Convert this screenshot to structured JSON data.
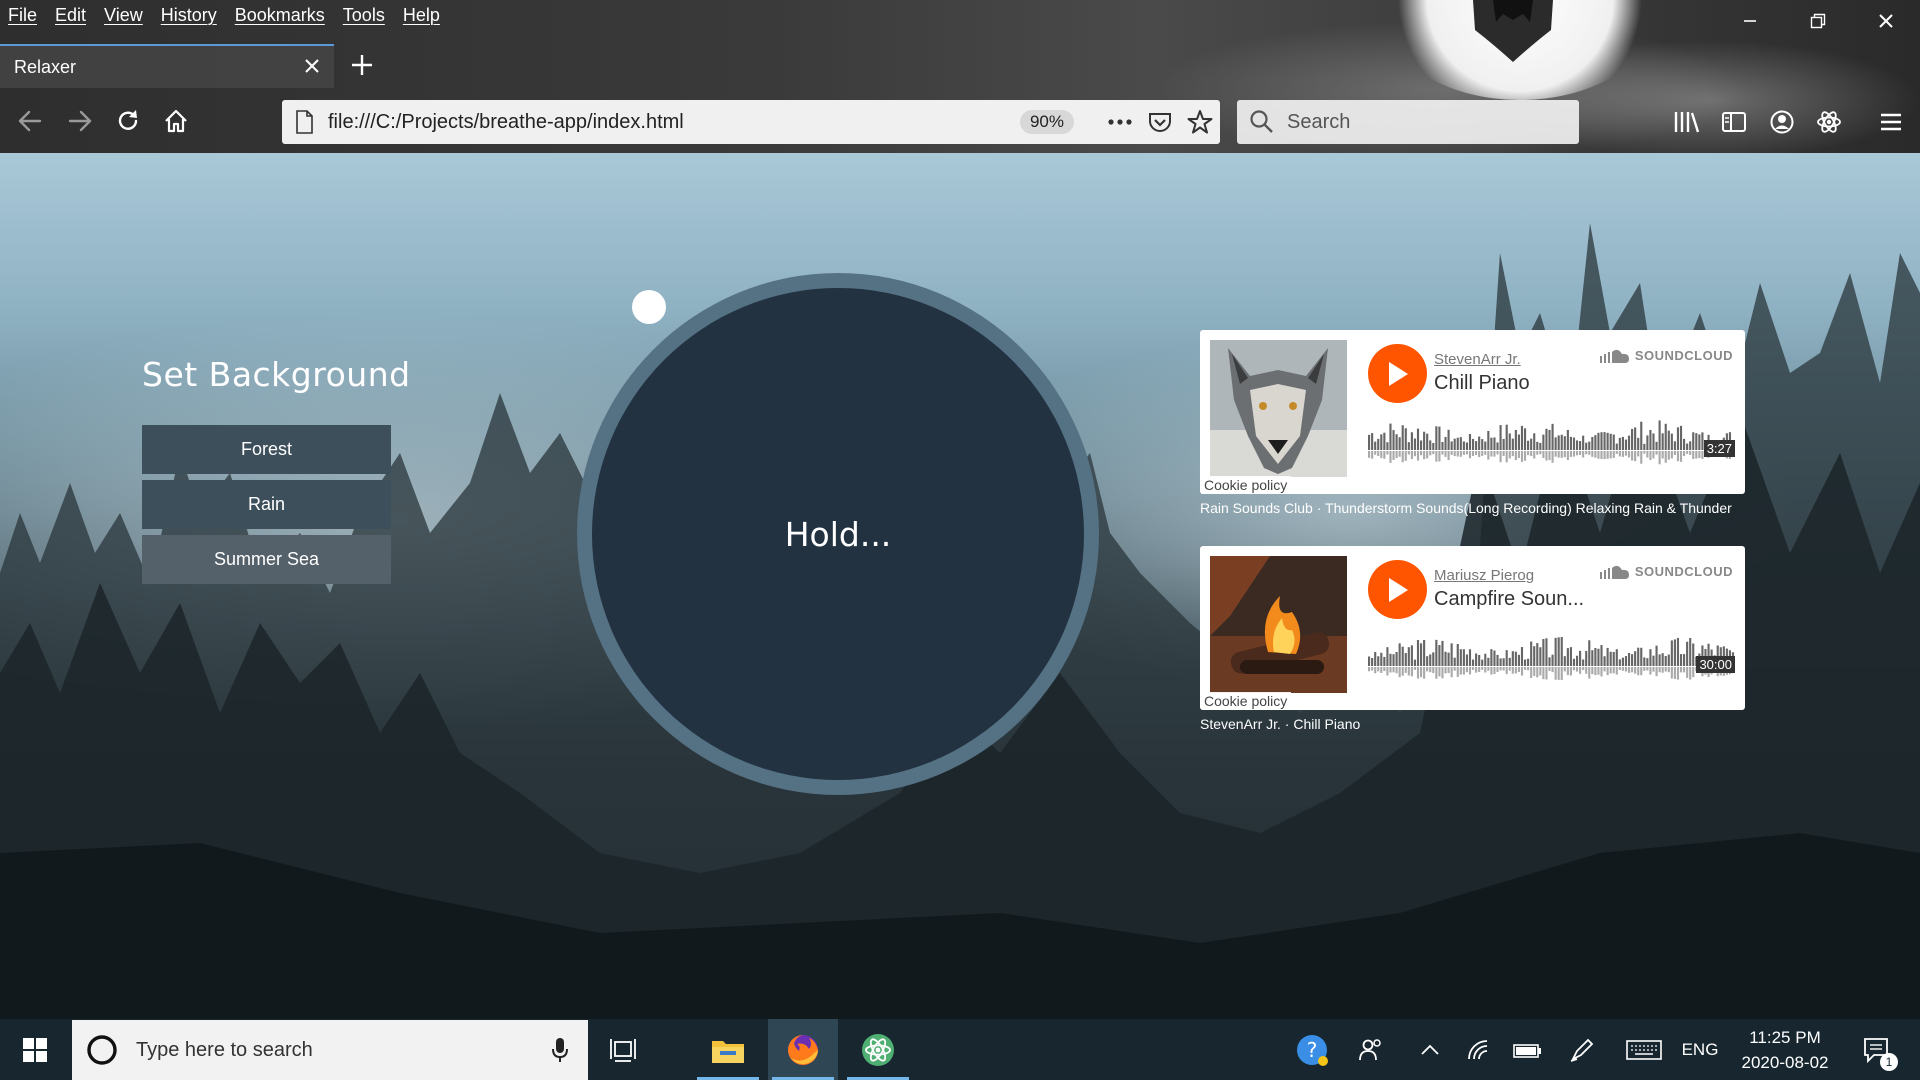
{
  "browser": {
    "menu": [
      "File",
      "Edit",
      "View",
      "History",
      "Bookmarks",
      "Tools",
      "Help"
    ],
    "tab_title": "Relaxer",
    "url": "file:///C:/Projects/breathe-app/index.html",
    "zoom": "90%",
    "search_placeholder": "Search"
  },
  "page": {
    "set_background_title": "Set Background",
    "background_buttons": [
      "Forest",
      "Rain",
      "Summer Sea"
    ],
    "circle_text": "Hold..."
  },
  "players": [
    {
      "artist": "StevenArr Jr.",
      "track": "Chill Piano",
      "brand": "SOUNDCLOUD",
      "duration": "3:27",
      "cookie": "Cookie policy",
      "caption": "Rain Sounds Club · Thunderstorm Sounds(Long Recording) Relaxing Rain & Thunder"
    },
    {
      "artist": "Mariusz Pierog",
      "track": "Campfire Soun...",
      "brand": "SOUNDCLOUD",
      "duration": "30:00",
      "cookie": "Cookie policy",
      "caption": "StevenArr Jr. · Chill Piano"
    }
  ],
  "taskbar": {
    "search_placeholder": "Type here to search",
    "language": "ENG",
    "time": "11:25 PM",
    "date": "2020-08-02",
    "notification_count": "1"
  },
  "colors": {
    "accent_soundcloud": "#ff5500",
    "circle": "#223241",
    "ring": "#557184",
    "button": "#3e4f5c"
  }
}
